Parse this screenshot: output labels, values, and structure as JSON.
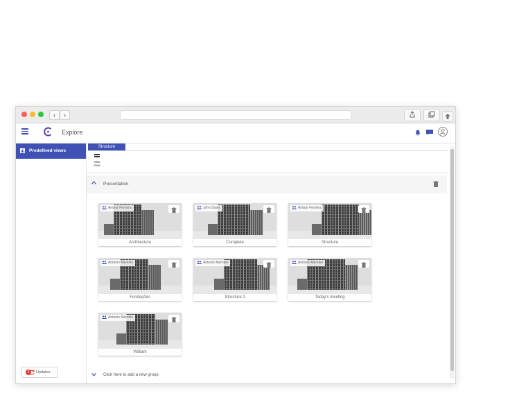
{
  "colors": {
    "accent": "#3f51b5",
    "badge": "#e53935"
  },
  "browser": {
    "traffic_lights": [
      "#ff5f57",
      "#febc2e",
      "#28c840"
    ],
    "back_icon": "chevron-left-icon",
    "forward_icon": "chevron-right-icon",
    "back_glyph": "‹",
    "forward_glyph": "›"
  },
  "app": {
    "title": "Explore",
    "menu_icon": "hamburger-icon",
    "header_icons": [
      "bell-icon",
      "chat-icon",
      "account-icon"
    ]
  },
  "sidebar": {
    "items": [
      {
        "label": "Predefined views",
        "icon": "chart-icon",
        "active": true
      }
    ],
    "updates": {
      "label": "Updates",
      "badge": "1"
    }
  },
  "main": {
    "tabs": [
      {
        "label": "Structure",
        "active": true
      }
    ],
    "new_view": {
      "line1": "New",
      "line2": "View"
    },
    "groups": [
      {
        "title": "Presentation",
        "expanded": true,
        "views": [
          {
            "owner": "Ambar Ferreira",
            "name": "Architecture"
          },
          {
            "owner": "John Davis",
            "name": "Complete"
          },
          {
            "owner": "Ambar Ferreira",
            "name": "Structure"
          },
          {
            "owner": "Antonio Mendes",
            "name": "Fundações"
          },
          {
            "owner": "Antonio Mendes",
            "name": "Structure 2"
          },
          {
            "owner": "Antonio Mendes",
            "name": "Today's meeting"
          },
          {
            "owner": "Antonio Mendes",
            "name": "William"
          }
        ]
      }
    ],
    "add_group_label": "Click here to add a new group"
  }
}
